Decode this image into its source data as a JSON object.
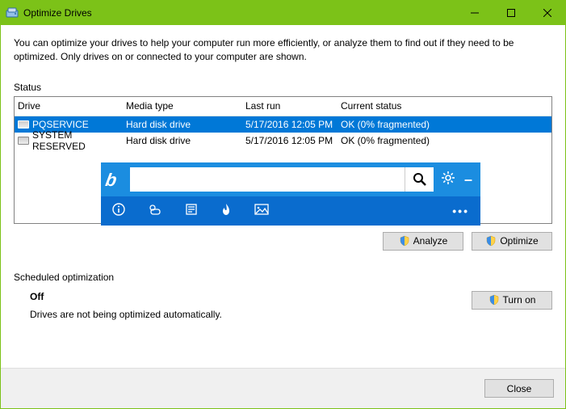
{
  "window": {
    "title": "Optimize Drives"
  },
  "description": "You can optimize your drives to help your computer run more efficiently, or analyze them to find out if they need to be optimized. Only drives on or connected to your computer are shown.",
  "status_label": "Status",
  "table": {
    "headers": {
      "drive": "Drive",
      "media": "Media type",
      "last": "Last run",
      "status": "Current status"
    },
    "rows": [
      {
        "drive": "PQSERVICE",
        "media": "Hard disk drive",
        "last": "5/17/2016 12:05 PM",
        "status": "OK (0% fragmented)",
        "selected": true
      },
      {
        "drive": "SYSTEM RESERVED",
        "media": "Hard disk drive",
        "last": "5/17/2016 12:05 PM",
        "status": "OK (0% fragmented)",
        "selected": false
      }
    ]
  },
  "buttons": {
    "analyze": "Analyze",
    "optimize": "Optimize",
    "turnon": "Turn on",
    "close": "Close"
  },
  "sched": {
    "label": "Scheduled optimization",
    "state": "Off",
    "msg": "Drives are not being optimized automatically."
  },
  "bing": {
    "search_value": "",
    "placeholder": ""
  }
}
